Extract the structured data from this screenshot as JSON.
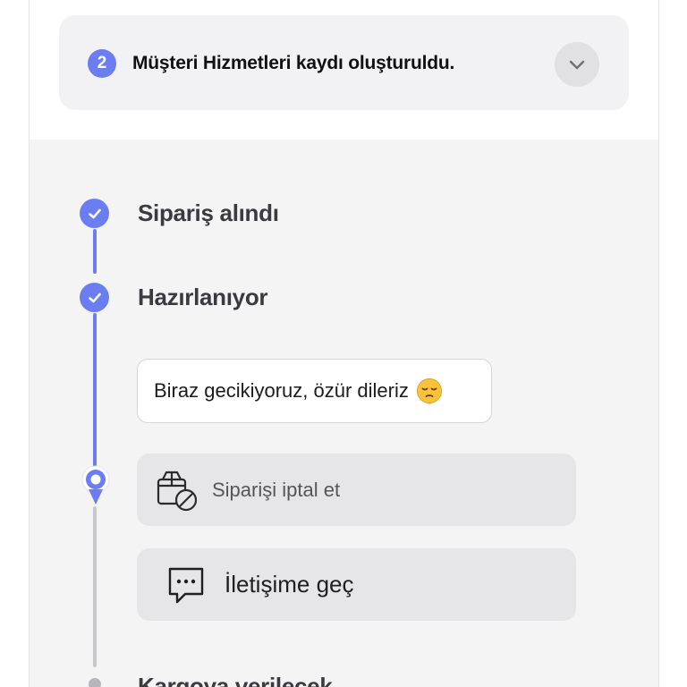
{
  "notice": {
    "badge": "2",
    "text": "Müşteri Hizmetleri kaydı oluşturuldu.",
    "toggle_icon": "chevron-down-icon"
  },
  "timeline": {
    "steps": [
      {
        "label": "Sipariş alındı",
        "status": "completed",
        "icon": "check-icon"
      },
      {
        "label": "Hazırlanıyor",
        "status": "completed",
        "icon": "check-icon"
      },
      {
        "label": "Kargoya verilecek",
        "status": "pending"
      }
    ],
    "message": {
      "text": "Biraz gecikiyoruz, özür dileriz",
      "emoji": "pensive-face-emoji"
    },
    "actions": [
      {
        "label": "Siparişi iptal et",
        "icon": "package-cancel-icon"
      },
      {
        "label": "İletişime geç",
        "icon": "chat-bubble-icon"
      }
    ]
  },
  "colors": {
    "accent": "#6a7ef2",
    "card_bg": "#f2f2f4",
    "timeline_bg": "#f4f4f5",
    "action_bg": "#e6e6e8",
    "pending": "#c7c7cc"
  }
}
